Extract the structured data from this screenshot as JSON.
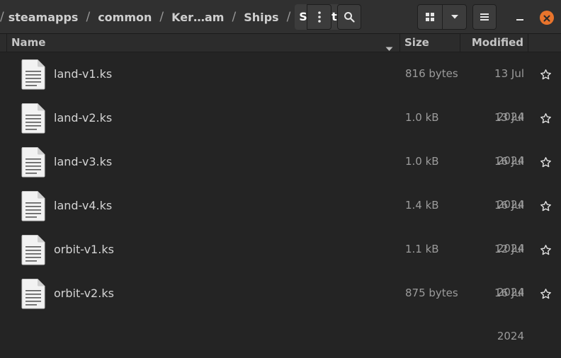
{
  "window": {
    "breadcrumb": [
      {
        "label": "steamapps",
        "current": false
      },
      {
        "label": "common",
        "current": false
      },
      {
        "label": "Ker…am",
        "current": false
      },
      {
        "label": "Ships",
        "current": false
      },
      {
        "label": "Script",
        "current": true
      }
    ],
    "separator": "/"
  },
  "columns": {
    "name": "Name",
    "size": "Size",
    "modified": "Modified"
  },
  "files": [
    {
      "name": "land-v1.ks",
      "size": "816 bytes",
      "modified": "13 Jul 2024"
    },
    {
      "name": "land-v2.ks",
      "size": "1.0 kB",
      "modified": "13 Jul 2024"
    },
    {
      "name": "land-v3.ks",
      "size": "1.0 kB",
      "modified": "16 Jul 2024"
    },
    {
      "name": "land-v4.ks",
      "size": "1.4 kB",
      "modified": "16 Jul 2024"
    },
    {
      "name": "orbit-v1.ks",
      "size": "1.1 kB",
      "modified": "12 Jul 2024"
    },
    {
      "name": "orbit-v2.ks",
      "size": "875 bytes",
      "modified": "16 Jul 2024"
    }
  ],
  "icons": {
    "file": "text-file-icon",
    "star": "star-outline-icon",
    "menu": "vertical-dots-icon",
    "search": "search-icon",
    "grid": "grid-view-icon",
    "dropdown": "chevron-down-icon",
    "hamburger": "hamburger-menu-icon",
    "minimize": "minimize-icon",
    "close": "close-icon"
  },
  "colors": {
    "background": "#242424",
    "headerbar": "#303030",
    "close_accent": "#e8742c"
  }
}
